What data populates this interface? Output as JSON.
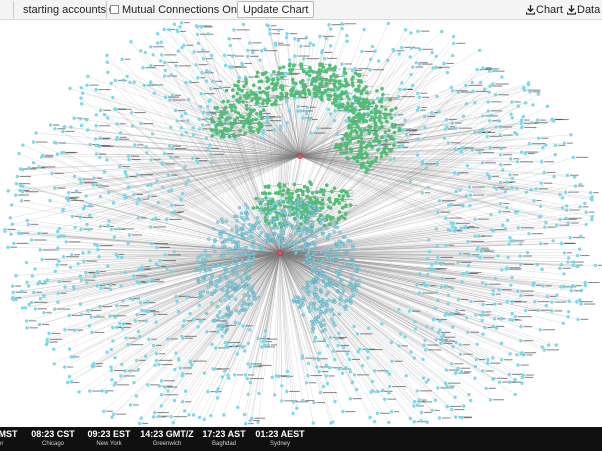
{
  "toolbar": {
    "starting_label": "starting accounts",
    "starting_help": "?",
    "mutual_label": "Mutual Connections Only",
    "mutual_help": "?",
    "mutual_checked": false,
    "update_button": "Update Chart",
    "chart_download": "Chart",
    "data_download": "Data"
  },
  "graph": {
    "colors": {
      "outer_node": "#6fd6e8",
      "inner_cluster_node": "#4dbb73",
      "hub_node": "#e0506a",
      "edge": "#7d7d7d",
      "label": "#333333"
    }
  },
  "clocks": [
    {
      "time": "MST",
      "city": "er"
    },
    {
      "time": "08:23 CST",
      "city": "Chicago"
    },
    {
      "time": "09:23 EST",
      "city": "New York"
    },
    {
      "time": "14:23 GMT/Z",
      "city": "Greenwich"
    },
    {
      "time": "17:23 AST",
      "city": "Baghdad"
    },
    {
      "time": "01:23 AEST",
      "city": "Sydney"
    }
  ]
}
